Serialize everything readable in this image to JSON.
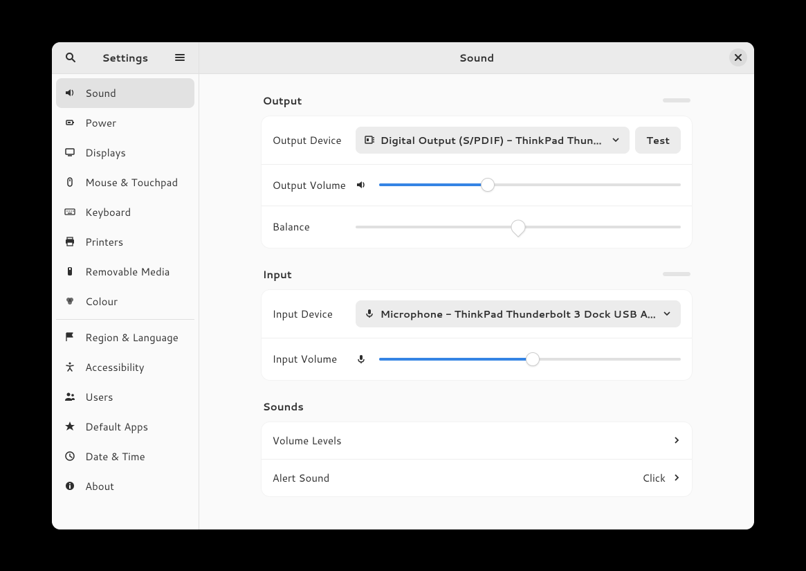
{
  "header": {
    "sidebar_title": "Settings",
    "main_title": "Sound"
  },
  "sidebar": {
    "items": [
      {
        "icon": "sound",
        "label": "Sound",
        "active": true
      },
      {
        "icon": "power",
        "label": "Power"
      },
      {
        "icon": "displays",
        "label": "Displays"
      },
      {
        "icon": "mouse",
        "label": "Mouse & Touchpad"
      },
      {
        "icon": "keyboard",
        "label": "Keyboard"
      },
      {
        "icon": "printers",
        "label": "Printers"
      },
      {
        "icon": "removable",
        "label": "Removable Media"
      },
      {
        "icon": "colour",
        "label": "Colour"
      },
      {
        "divider": true
      },
      {
        "icon": "region",
        "label": "Region & Language"
      },
      {
        "icon": "accessibility",
        "label": "Accessibility"
      },
      {
        "icon": "users",
        "label": "Users"
      },
      {
        "icon": "defaultapps",
        "label": "Default Apps"
      },
      {
        "icon": "datetime",
        "label": "Date & Time"
      },
      {
        "icon": "about",
        "label": "About"
      }
    ]
  },
  "output": {
    "section_title": "Output",
    "device_label": "Output Device",
    "device_selected": "Digital Output (S/PDIF) - ThinkPad Thun…",
    "test_label": "Test",
    "volume_label": "Output Volume",
    "volume_percent": 36,
    "balance_label": "Balance",
    "balance_percent": 50
  },
  "input": {
    "section_title": "Input",
    "device_label": "Input Device",
    "device_selected": "Microphone - ThinkPad Thunderbolt 3 Dock USB A…",
    "volume_label": "Input Volume",
    "volume_percent": 51
  },
  "sounds": {
    "section_title": "Sounds",
    "volume_levels_label": "Volume Levels",
    "alert_sound_label": "Alert Sound",
    "alert_sound_value": "Click"
  }
}
